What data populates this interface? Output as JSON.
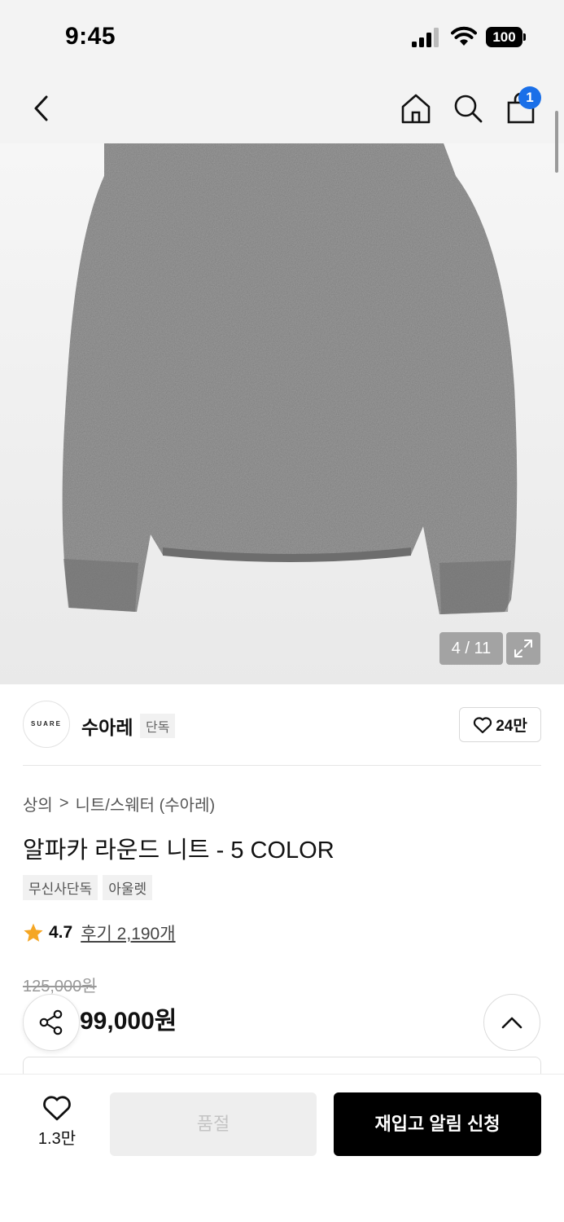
{
  "status_bar": {
    "time": "9:45",
    "battery": "100"
  },
  "nav": {
    "cart_count": "1",
    "icons": [
      "back-icon",
      "home-icon",
      "search-icon",
      "cart-icon"
    ]
  },
  "gallery": {
    "counter": "4 / 11",
    "image": "gray alpaca round-neck knit sweater"
  },
  "brand": {
    "logo_text": "SUARE",
    "name": "수아레",
    "tag": "단독",
    "likes": "24만"
  },
  "breadcrumb": {
    "category": "상의",
    "separator": ">",
    "subcategory": "니트/스웨터 (수아레)"
  },
  "product": {
    "title": "알파카 라운드 니트 - 5 COLOR",
    "tags": [
      "무신사단독",
      "아울렛"
    ],
    "rating": "4.7",
    "reviews": "후기 2,190개",
    "original_price": "125,000원",
    "price": "99,000원"
  },
  "bottom_bar": {
    "wish_count": "1.3만",
    "soldout_label": "품절",
    "restock_label": "재입고 알림 신청"
  },
  "colors": {
    "accent": "#1a6fe8",
    "star": "#f5a623",
    "primary_button": "#000000"
  }
}
